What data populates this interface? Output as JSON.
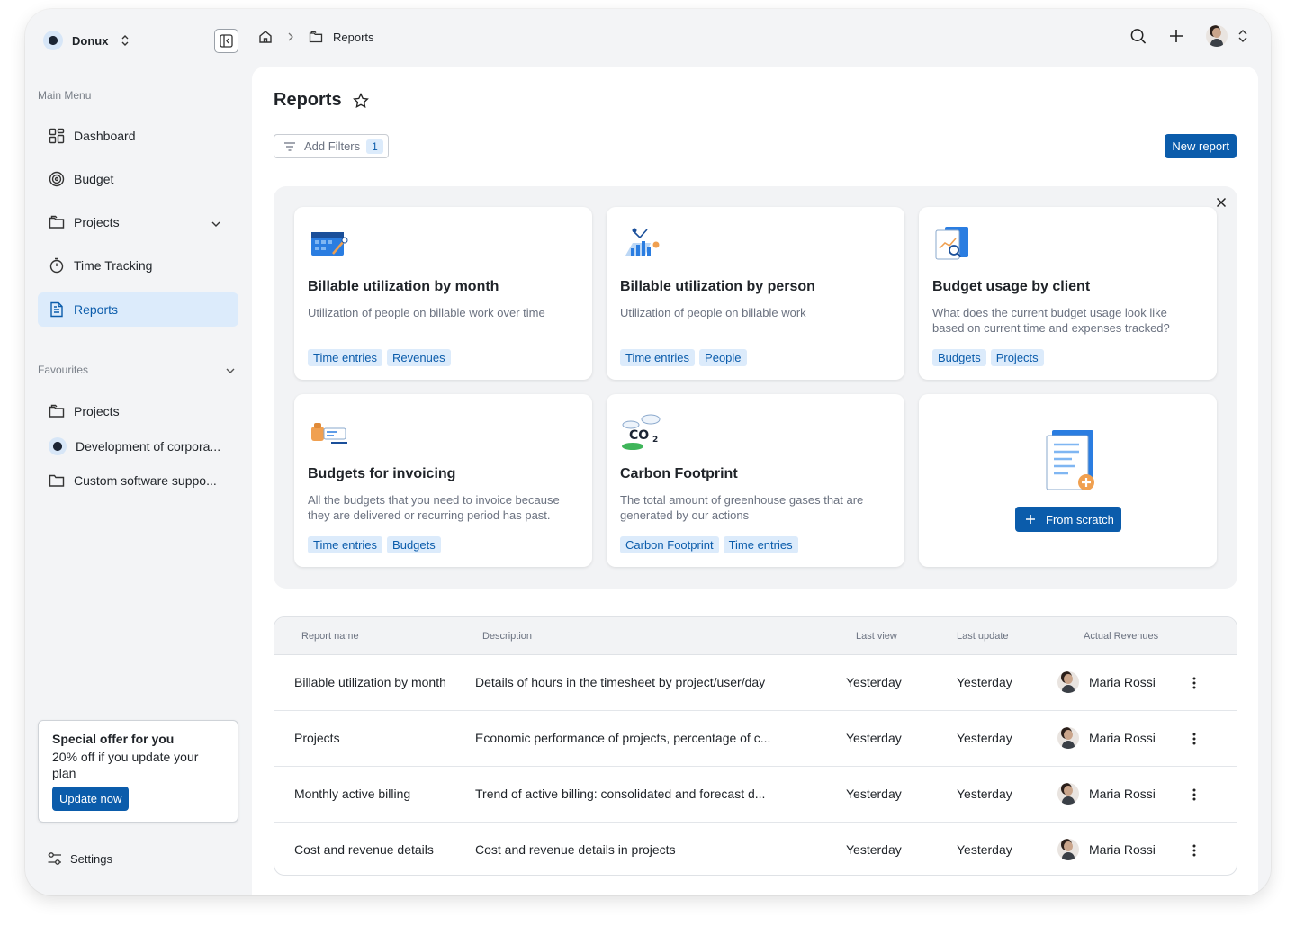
{
  "workspace": {
    "name": "Donux"
  },
  "sidebar": {
    "main_menu_label": "Main Menu",
    "items": [
      {
        "label": "Dashboard",
        "icon": "grid-icon"
      },
      {
        "label": "Budget",
        "icon": "target-icon"
      },
      {
        "label": "Projects",
        "icon": "folder-icon"
      },
      {
        "label": "Time Tracking",
        "icon": "stopwatch-icon"
      },
      {
        "label": "Reports",
        "icon": "document-icon",
        "active": true
      }
    ],
    "favourites_label": "Favourites",
    "favourites": [
      {
        "label": "Projects"
      },
      {
        "label": "Development of corpora..."
      },
      {
        "label": "Custom software suppo..."
      }
    ],
    "offer": {
      "title": "Special offer for you",
      "text": "20% off if you update your plan",
      "button": "Update now"
    },
    "settings_label": "Settings"
  },
  "breadcrumb": {
    "current": "Reports"
  },
  "page": {
    "title": "Reports",
    "filter_label": "Add Filters",
    "filter_count": "1",
    "new_report_label": "New report"
  },
  "templates": [
    {
      "title": "Billable utilization by month",
      "description": "Utilization of people on billable work over time",
      "tags": [
        "Time entries",
        "Revenues"
      ]
    },
    {
      "title": "Billable utilization by person",
      "description": "Utilization of people on billable work",
      "tags": [
        "Time entries",
        "People"
      ]
    },
    {
      "title": "Budget usage by client",
      "description": "What does the current budget usage look like based on current time and expenses tracked?",
      "tags": [
        "Budgets",
        "Projects"
      ]
    },
    {
      "title": "Budgets for invoicing",
      "description": "All the budgets that you need to invoice because they are delivered or recurring period has past.",
      "tags": [
        "Time entries",
        "Budgets"
      ]
    },
    {
      "title": "Carbon Footprint",
      "description": "The total amount of greenhouse gases that are generated by our actions",
      "tags": [
        "Carbon Footprint",
        "Time entries"
      ]
    }
  ],
  "scratch": {
    "label": "From scratch"
  },
  "table": {
    "headers": [
      "Report name",
      "Description",
      "Last view",
      "Last update",
      "Actual Revenues"
    ],
    "rows": [
      {
        "name": "Billable utilization by month",
        "description": "Details of hours in the timesheet by project/user/day",
        "last_view": "Yesterday",
        "last_update": "Yesterday",
        "owner": "Maria Rossi"
      },
      {
        "name": "Projects",
        "description": "Economic performance of projects, percentage of c...",
        "last_view": "Yesterday",
        "last_update": "Yesterday",
        "owner": "Maria Rossi"
      },
      {
        "name": "Monthly active billing",
        "description": "Trend of active billing: consolidated and forecast d...",
        "last_view": "Yesterday",
        "last_update": "Yesterday",
        "owner": "Maria Rossi"
      },
      {
        "name": "Cost and revenue details",
        "description": "Cost and revenue details in projects",
        "last_view": "Yesterday",
        "last_update": "Yesterday",
        "owner": "Maria Rossi"
      }
    ]
  },
  "colors": {
    "accent": "#0b5cab",
    "accent_soft": "#dcebfb",
    "background": "#f3f4f6"
  }
}
